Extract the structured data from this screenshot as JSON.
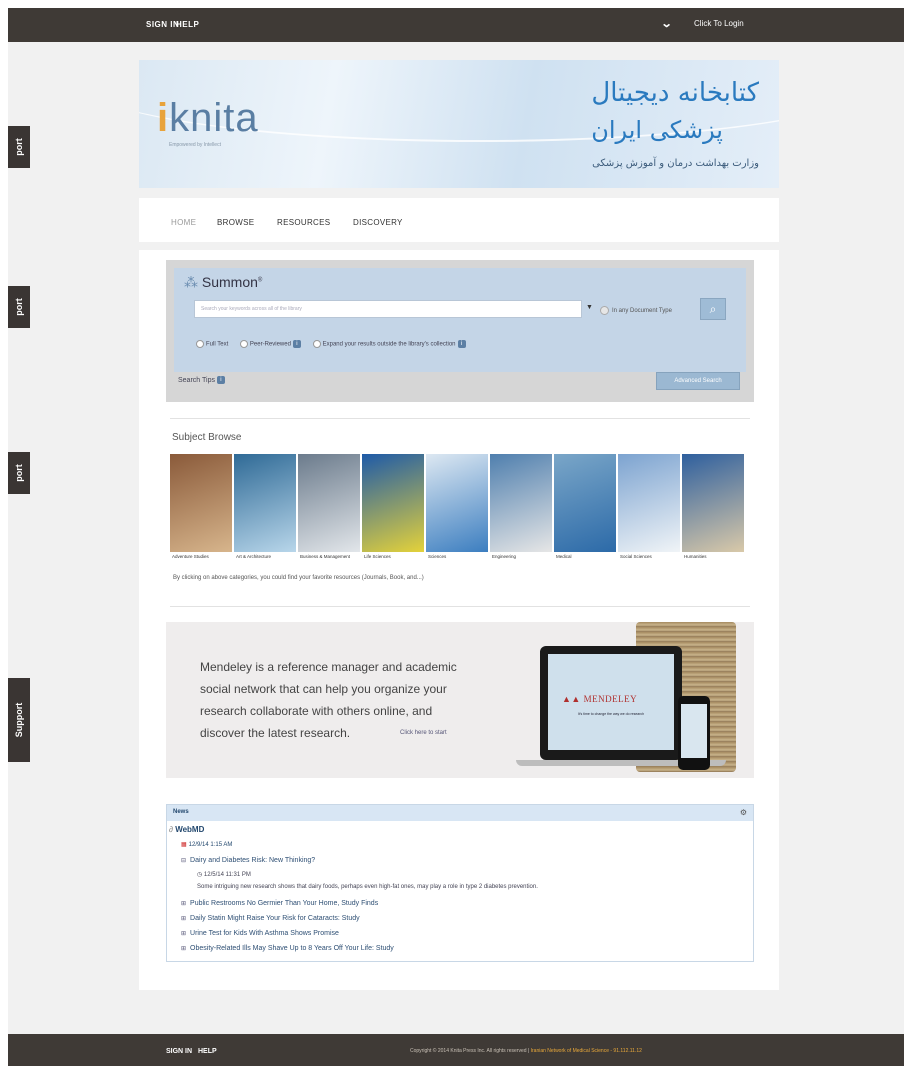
{
  "top_bar": {
    "links": [
      "SIGN IN",
      "HELP"
    ],
    "login_label": "Click To Login",
    "chevron_icon": "chevron-down-icon"
  },
  "support_tabs": [
    {
      "label": "port"
    },
    {
      "label": "port"
    },
    {
      "label": "port"
    },
    {
      "label": "Support"
    }
  ],
  "banner": {
    "logo_text": "knita",
    "logo_i": "i",
    "logo_sub": "Empowered by Intellect",
    "fa_line1": "کتابخانه دیجیتال",
    "fa_line2": "پزشکی ایران",
    "fa_line3": "وزارت بهداشت درمان و آموزش پزشکی"
  },
  "nav": {
    "items": [
      "HOME",
      "BROWSE",
      "RESOURCES",
      "DISCOVERY"
    ]
  },
  "summon": {
    "logo_mark": "⁂",
    "title": "Summon",
    "title_mark": "®",
    "search_placeholder": "Search your keywords across all of the library",
    "dropdown_arrow": "▼",
    "type_label": "In any Document Type",
    "search_button_icon": "search-icon",
    "options": [
      "Full Text",
      "Peer-Reviewed",
      "Expand your results outside the library's collection"
    ],
    "search_tips": "Search Tips",
    "advanced_search": "Advanced Search"
  },
  "subject_browse": {
    "title": "Subject Browse",
    "tiles": [
      {
        "caption": "Adventure Studies",
        "color_a": "#8a5a3a",
        "color_b": "#d7b58c"
      },
      {
        "caption": "Art & Architecture",
        "color_a": "#2f6a96",
        "color_b": "#b8d6ea"
      },
      {
        "caption": "Business & Management",
        "color_a": "#6b7b8c",
        "color_b": "#e2e6ea"
      },
      {
        "caption": "Life Sciences",
        "color_a": "#1e5aa8",
        "color_b": "#e4d23a"
      },
      {
        "caption": "Sciences",
        "color_a": "#dde8f2",
        "color_b": "#3c7ec0"
      },
      {
        "caption": "Engineering",
        "color_a": "#4f7fae",
        "color_b": "#e6e6e6"
      },
      {
        "caption": "Medical",
        "color_a": "#7aa6c8",
        "color_b": "#2c6aa8"
      },
      {
        "caption": "Social Sciences",
        "color_a": "#7ca3d0",
        "color_b": "#f0f4f7"
      },
      {
        "caption": "Humanities",
        "color_a": "#2e5f9e",
        "color_b": "#d9c9a9"
      }
    ],
    "note": "By clicking on above categories, you could find your favorite resources (Journals, Book, and...)"
  },
  "mendeley": {
    "text": "Mendeley is a reference manager and academic social network that can help you organize your research collaborate with others online, and discover the latest research.",
    "link": "Click here to start",
    "brand": "MENDELEY",
    "tagline": "It's time to change the way we do research"
  },
  "news": {
    "header": "News",
    "settings_icon": "gear-icon",
    "source": "WebMD",
    "date": "12/9/14 1:15 AM",
    "items": [
      "Dairy and Diabetes Risk: New Thinking?",
      "Public Restrooms No Germier Than Your Home, Study Finds",
      "Daily Statin Might Raise Your Risk for Cataracts: Study",
      "Urine Test for Kids With Asthma Shows Promise",
      "Obesity-Related Ills May Shave Up to 8 Years Off Your Life: Study"
    ],
    "item1_time": "12/5/14 11:31 PM",
    "item1_desc": "Some intriguing new research shows that dairy foods, perhaps even high-fat ones, may play a role in type 2 diabetes prevention."
  },
  "footer": {
    "links": [
      "SIGN IN",
      "HELP"
    ],
    "copyright": "Copyright © 2014 Knita Press Inc. All rights reserved |",
    "highlight": "Iranian Network of Medical Science - 91.112.11.12"
  }
}
